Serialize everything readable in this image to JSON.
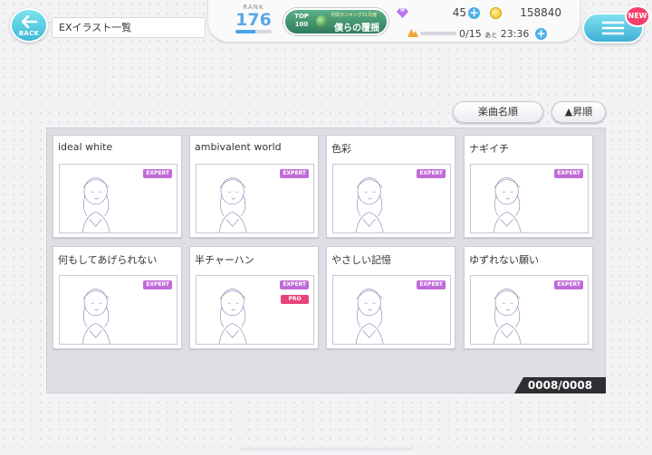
{
  "header": {
    "back_label": "BACK",
    "page_title": "EXイラスト一覧",
    "rank_label": "RANK",
    "rank_value": "176",
    "rank_progress": 0.55,
    "event": {
      "top_line1": "TOP",
      "top_line2": "100",
      "subtitle": "月間ランキング11月度",
      "name": "僕らの覆揺"
    },
    "gems": "45",
    "coins": "158840",
    "stamina": "0/15",
    "stamina_time_prefix": "あと",
    "stamina_time": "23:36",
    "new_badge": "NEW",
    "accent_color": "#4eb0ea"
  },
  "sort": {
    "sort_label": "楽曲名順",
    "order_label": "▲昇順"
  },
  "cards": [
    {
      "title": "ideal white",
      "badges": [
        "EXPERT"
      ]
    },
    {
      "title": "ambivalent world",
      "badges": [
        "EXPERT"
      ]
    },
    {
      "title": "色彩",
      "badges": [
        "EXPERT"
      ]
    },
    {
      "title": "ナギイチ",
      "badges": [
        "EXPERT"
      ]
    },
    {
      "title": "何もしてあげられない",
      "badges": [
        "EXPERT"
      ]
    },
    {
      "title": "半チャーハン",
      "badges": [
        "EXPERT",
        "PRO"
      ]
    },
    {
      "title": "やさしい記憶",
      "badges": [
        "EXPERT"
      ]
    },
    {
      "title": "ゆずれない願い",
      "badges": [
        "EXPERT"
      ]
    }
  ],
  "counter": "0008/0008"
}
